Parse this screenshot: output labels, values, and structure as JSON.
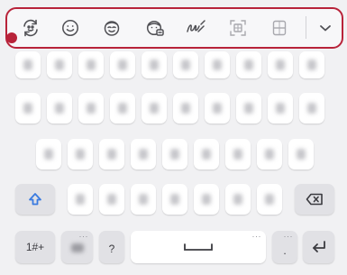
{
  "toolbar": {
    "items": [
      {
        "name": "expression-prediction-icon"
      },
      {
        "name": "emoji-icon"
      },
      {
        "name": "sticker-icon"
      },
      {
        "name": "gif-icon"
      },
      {
        "name": "handwriting-icon"
      },
      {
        "name": "screenshot-icon"
      },
      {
        "name": "clipboard-icon"
      },
      {
        "name": "chevron-down-icon"
      }
    ],
    "accent_color": "#b8233a"
  },
  "keys": {
    "symbols_label": "1#+",
    "question_label": "?",
    "period_label": ".",
    "more_dots": "···",
    "colors": {
      "shift": "#3a7be0",
      "key_bg": "#ffffff",
      "fn_bg": "#e1e1e5"
    }
  }
}
